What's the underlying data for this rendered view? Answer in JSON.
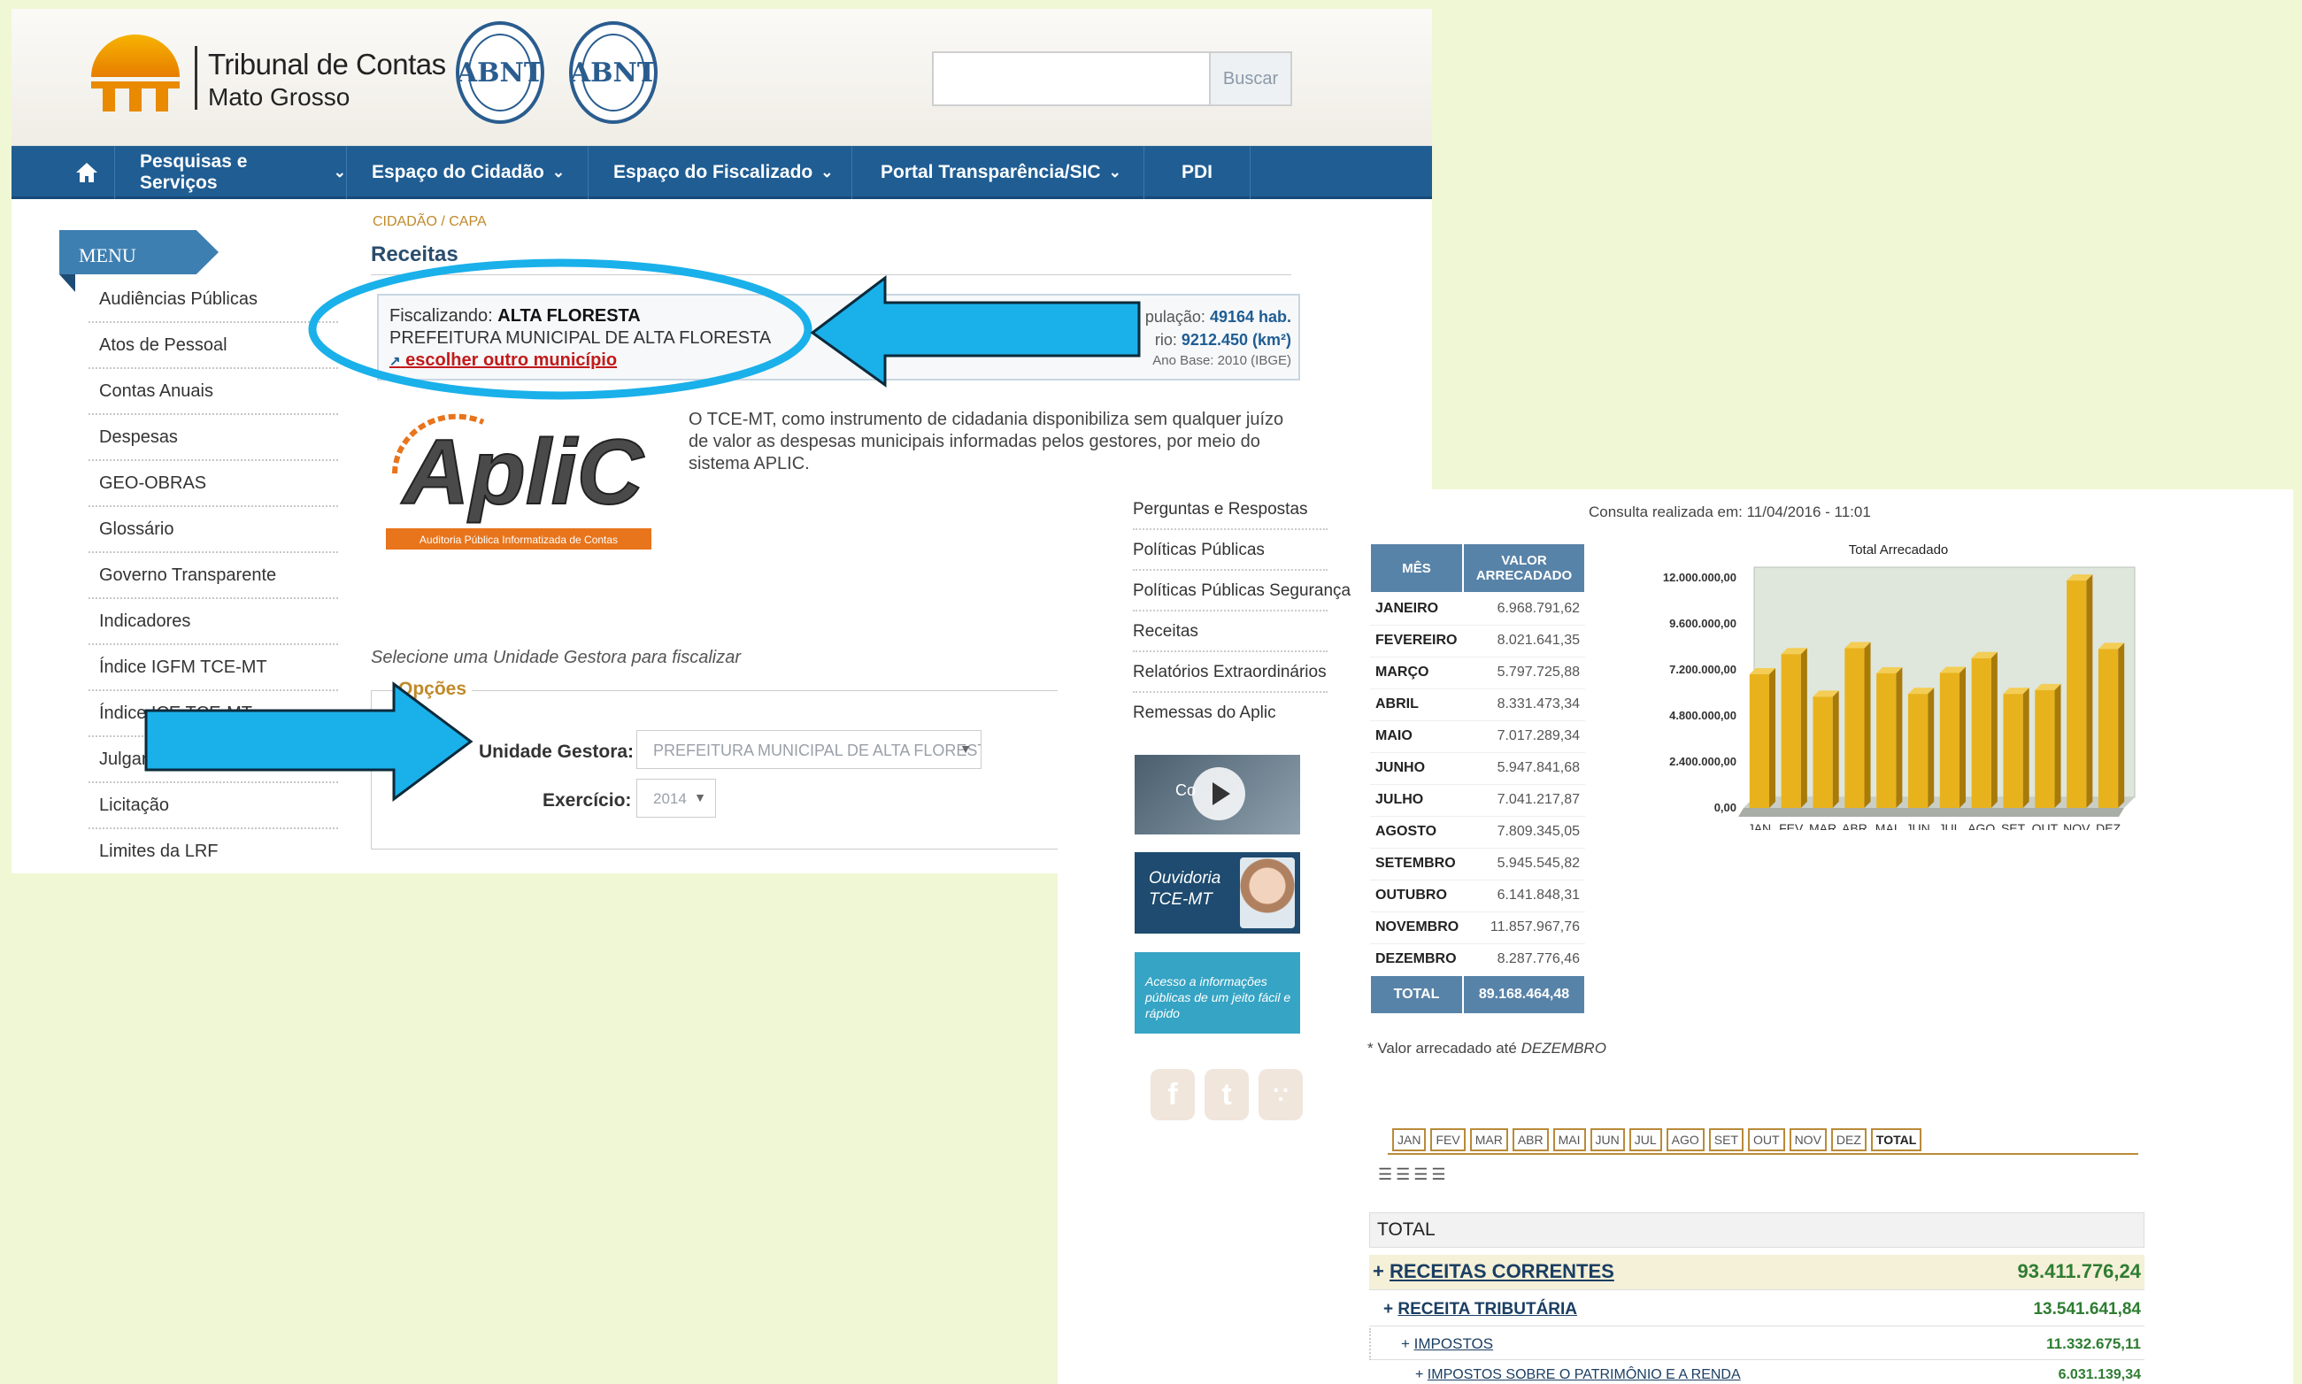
{
  "header": {
    "logo_title": "Tribunal de Contas",
    "logo_subtitle": "Mato Grosso",
    "seal_text": "ABNT",
    "search_placeholder": "",
    "search_button": "Buscar"
  },
  "nav": {
    "home_icon": "home-icon",
    "items": [
      {
        "label": "Pesquisas e Serviços",
        "dropdown": true
      },
      {
        "label": "Espaço do Cidadão",
        "dropdown": true
      },
      {
        "label": "Espaço do Fiscalizado",
        "dropdown": true
      },
      {
        "label": "Portal Transparência/SIC",
        "dropdown": true
      },
      {
        "label": "PDI",
        "dropdown": false
      }
    ]
  },
  "breadcrumb": "CIDADÃO / CAPA",
  "page_title": "Receitas",
  "menu": {
    "title": "MENU",
    "items": [
      "Audiências Públicas",
      "Atos de Pessoal",
      "Contas Anuais",
      "Despesas",
      "GEO-OBRAS",
      "Glossário",
      "Governo Transparente",
      "Indicadores",
      "Índice IGFM TCE-MT",
      "Índice ICE TCE-MT",
      "Julgamentos",
      "Licitação",
      "Limites da LRF"
    ]
  },
  "fiscalizando": {
    "label": "Fiscalizando:",
    "municipio": "ALTA FLORESTA",
    "entidade": "PREFEITURA MUNICIPAL DE ALTA FLORESTA",
    "link": "escolher outro município",
    "populacao_label": "pulação:",
    "populacao": "49164 hab.",
    "territorio_label": "rio:",
    "territorio": "9212.450 (km²)",
    "ano_base": "Ano Base: 2010 (IBGE)"
  },
  "aplic": {
    "logo_text": "ApliC",
    "logo_caption": "Auditoria Pública Informatizada de Contas",
    "description": "O TCE-MT, como instrumento de cidadania disponibiliza sem qualquer juízo de valor as despesas municipais informadas pelos gestores, por meio do sistema APLIC."
  },
  "form": {
    "select_label": "Selecione uma Unidade Gestora para fiscalizar",
    "legend": "Opções",
    "ug_label": "Unidade Gestora:",
    "ug_value": "PREFEITURA MUNICIPAL DE ALTA FLORESTA",
    "ex_label": "Exercício:",
    "ex_value": "2014"
  },
  "sidebar2": {
    "links": [
      "Perguntas e Respostas",
      "Políticas Públicas",
      "Políticas Públicas Segurança",
      "Receitas",
      "Relatórios Extraordinários",
      "Remessas do Aplic"
    ],
    "video_label": "Co",
    "ouvidoria": "Ouvidoria TCE-MT",
    "acesso": "Acesso a informações públicas de um jeito fácil e rápido",
    "social_icons": [
      "facebook-icon",
      "twitter-icon",
      "rss-icon"
    ]
  },
  "consulta": "Consulta realizada em: 11/04/2016 - 11:01",
  "table": {
    "col_mes": "MÊS",
    "col_valor": "VALOR ARRECADADO",
    "rows": [
      {
        "mes": "JANEIRO",
        "valor": "6.968.791,62"
      },
      {
        "mes": "FEVEREIRO",
        "valor": "8.021.641,35"
      },
      {
        "mes": "MARÇO",
        "valor": "5.797.725,88"
      },
      {
        "mes": "ABRIL",
        "valor": "8.331.473,34"
      },
      {
        "mes": "MAIO",
        "valor": "7.017.289,34"
      },
      {
        "mes": "JUNHO",
        "valor": "5.947.841,68"
      },
      {
        "mes": "JULHO",
        "valor": "7.041.217,87"
      },
      {
        "mes": "AGOSTO",
        "valor": "7.809.345,05"
      },
      {
        "mes": "SETEMBRO",
        "valor": "5.945.545,82"
      },
      {
        "mes": "OUTUBRO",
        "valor": "6.141.848,31"
      },
      {
        "mes": "NOVEMBRO",
        "valor": "11.857.967,76"
      },
      {
        "mes": "DEZEMBRO",
        "valor": "8.287.776,46"
      }
    ],
    "total_label": "TOTAL",
    "total_value": "89.168.464,48"
  },
  "valor_note": "* Valor arrecadado até",
  "valor_note_month": "DEZEMBRO",
  "chart_data": {
    "type": "bar",
    "title": "Total Arrecadado",
    "categories": [
      "JAN",
      "FEV",
      "MAR",
      "ABR",
      "MAI",
      "JUN",
      "JUL",
      "AGO",
      "SET",
      "OUT",
      "NOV",
      "DEZ"
    ],
    "values": [
      6968791.62,
      8021641.35,
      5797725.88,
      8331473.34,
      7017289.34,
      5947841.68,
      7041217.87,
      7809345.05,
      5945545.82,
      6141848.31,
      11857967.76,
      8287776.46
    ],
    "yticks": [
      "12.000.000,00",
      "9.600.000,00",
      "7.200.000,00",
      "4.800.000,00",
      "2.400.000,00",
      "0,00"
    ],
    "ylim": [
      0,
      12000000
    ],
    "bar_color": "#e8b21c",
    "grid": false
  },
  "month_tabs": [
    "JAN",
    "FEV",
    "MAR",
    "ABR",
    "MAI",
    "JUN",
    "JUL",
    "AGO",
    "SET",
    "OUT",
    "NOV",
    "DEZ",
    "TOTAL"
  ],
  "total_header": "TOTAL",
  "tree": [
    {
      "label": "RECEITAS CORRENTES",
      "value": "93.411.776,24"
    },
    {
      "label": "RECEITA TRIBUTÁRIA",
      "value": "13.541.641,84"
    },
    {
      "label": "IMPOSTOS",
      "value": "11.332.675,11"
    },
    {
      "label": "IMPOSTOS SOBRE O PATRIMÔNIO E A RENDA",
      "value": "6.031.139,34"
    }
  ],
  "colors": {
    "nav": "#1f5d93",
    "annotation_blue": "#1ab0ea",
    "gold": "#e8b21c",
    "value_green": "#2e7d32"
  }
}
